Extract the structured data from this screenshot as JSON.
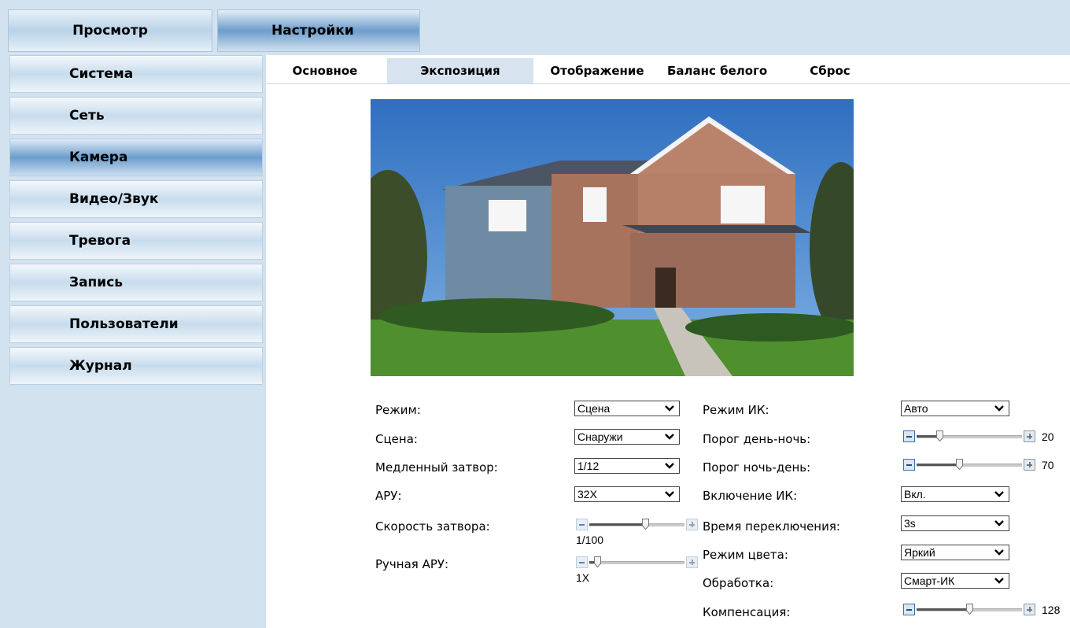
{
  "top_tabs": {
    "view": "Просмотр",
    "settings": "Настройки"
  },
  "sidebar": {
    "items": [
      {
        "label": "Система"
      },
      {
        "label": "Сеть"
      },
      {
        "label": "Камера"
      },
      {
        "label": "Видео/Звук"
      },
      {
        "label": "Тревога"
      },
      {
        "label": "Запись"
      },
      {
        "label": "Пользователи"
      },
      {
        "label": "Журнал"
      }
    ],
    "active": "Камера"
  },
  "subtabs": {
    "items": [
      {
        "label": "Основное"
      },
      {
        "label": "Экспозиция"
      },
      {
        "label": "Отображение"
      },
      {
        "label": "Баланс белого"
      },
      {
        "label": "Сброс"
      }
    ],
    "active": "Экспозиция"
  },
  "left_form": {
    "mode": {
      "label": "Режим:",
      "value": "Сцена"
    },
    "scene": {
      "label": "Сцена:",
      "value": "Снаружи"
    },
    "slow_shutter": {
      "label": "Медленный затвор:",
      "value": "1/12"
    },
    "agc": {
      "label": "АРУ:",
      "value": "32X"
    },
    "shutter_speed": {
      "label": "Скорость затвора:",
      "value": "1/100",
      "level": 0.6,
      "disabled": true
    },
    "manual_agc": {
      "label": "Ручная АРУ:",
      "value": "1X",
      "level": 0.05,
      "disabled": true
    }
  },
  "right_form": {
    "ir_mode": {
      "label": "Режим ИК:",
      "value": "Авто"
    },
    "day_night": {
      "label": "Порог день-ночь:",
      "value": "20",
      "level": 0.2
    },
    "night_day": {
      "label": "Порог ночь-день:",
      "value": "70",
      "level": 0.4
    },
    "ir_on": {
      "label": "Включение ИК:",
      "value": "Вкл."
    },
    "switch_time": {
      "label": "Время переключения:",
      "value": "3s"
    },
    "color_mode": {
      "label": "Режим цвета:",
      "value": "Яркий"
    },
    "processing": {
      "label": "Обработка:",
      "value": "Смарт-ИК"
    },
    "compensation": {
      "label": "Компенсация:",
      "value": "128",
      "level": 0.5
    }
  },
  "colors": {
    "accent": "#6c9dcd",
    "background": "#d2e2ef"
  }
}
